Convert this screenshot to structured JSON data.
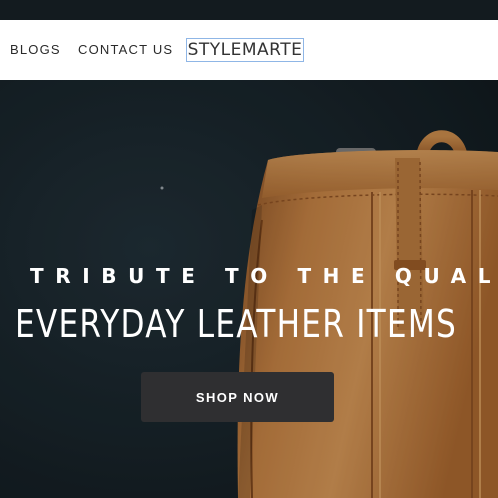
{
  "nav": {
    "items": [
      {
        "label": "BLOGS"
      },
      {
        "label": "CONTACT US"
      }
    ],
    "logo": "STYLEMARTE"
  },
  "hero": {
    "tagline": "TRIBUTE TO THE QUALITY",
    "headline": "EVERYDAY LEATHER ITEMS",
    "button_label": "SHOP NOW"
  },
  "colors": {
    "navbar_bg": "#ffffff",
    "hero_bg": "#18232a",
    "leather": "#b5733a",
    "button_bg": "#2f2f31",
    "logo_border": "#8fb6e6"
  }
}
